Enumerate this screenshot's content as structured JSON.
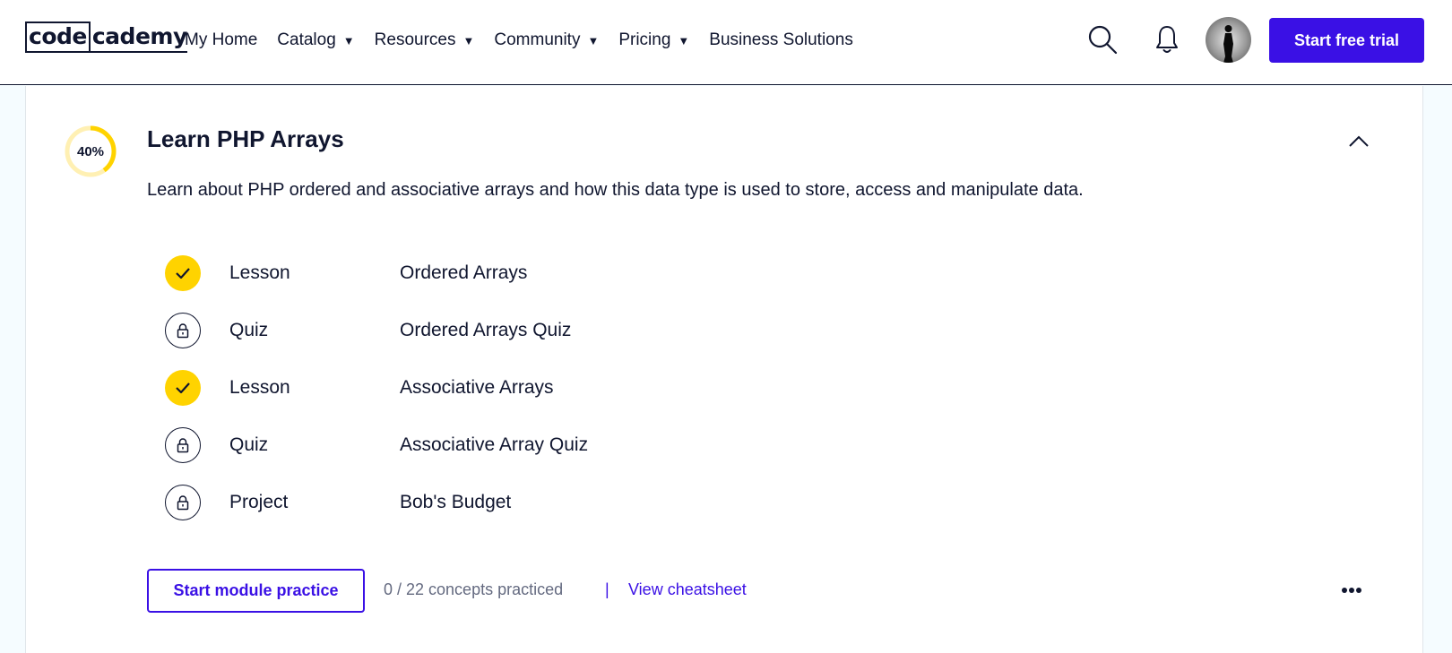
{
  "header": {
    "logo": {
      "part1": "code",
      "part2": "cademy"
    },
    "nav": [
      {
        "label": "My Home",
        "has_caret": false
      },
      {
        "label": "Catalog",
        "has_caret": true
      },
      {
        "label": "Resources",
        "has_caret": true
      },
      {
        "label": "Community",
        "has_caret": true
      },
      {
        "label": "Pricing",
        "has_caret": true
      },
      {
        "label": "Business Solutions",
        "has_caret": false
      }
    ],
    "caret_glyph": "▼",
    "cta_label": "Start free trial",
    "icons": {
      "search": "search-icon",
      "notifications": "bell-icon"
    }
  },
  "module": {
    "progress_percent": 40,
    "progress_label": "40%",
    "title": "Learn PHP Arrays",
    "description": "Learn about PHP ordered and associative arrays and how this data type is used to store, access and manipulate data.",
    "items": [
      {
        "type": "Lesson",
        "name": "Ordered Arrays",
        "status": "completed"
      },
      {
        "type": "Quiz",
        "name": "Ordered Arrays Quiz",
        "status": "locked"
      },
      {
        "type": "Lesson",
        "name": "Associative Arrays",
        "status": "completed"
      },
      {
        "type": "Quiz",
        "name": "Associative Array Quiz",
        "status": "locked"
      },
      {
        "type": "Project",
        "name": "Bob's Budget",
        "status": "locked"
      }
    ],
    "practice_button": "Start module practice",
    "concepts_text": "0 / 22 concepts practiced",
    "separator": "|",
    "cheatsheet_link": "View cheatsheet"
  },
  "colors": {
    "brand": "#3a10e5",
    "navy": "#10162f",
    "yellow": "#ffd300",
    "progress_track": "#fff0b3",
    "muted": "#646a80",
    "background": "#f5fcff"
  }
}
